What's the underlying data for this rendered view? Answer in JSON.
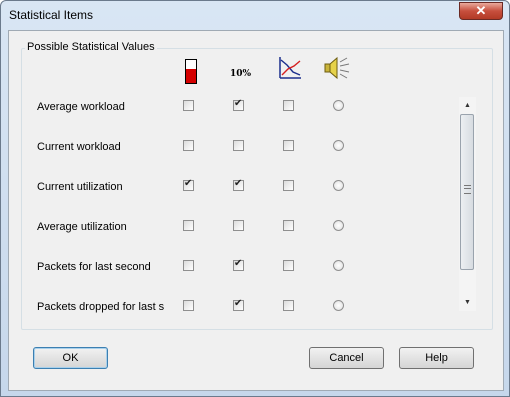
{
  "window": {
    "title": "Statistical Items",
    "close_glyph": "✕"
  },
  "group": {
    "label": "Possible Statistical Values"
  },
  "columns": [
    {
      "icon": "red-bar-gauge-icon"
    },
    {
      "icon": "percent-icon",
      "text": "10%"
    },
    {
      "icon": "line-graph-icon"
    },
    {
      "icon": "speaker-icon"
    }
  ],
  "rows": [
    {
      "label": "Average workload",
      "c1": false,
      "c2": true,
      "c3": false
    },
    {
      "label": "Current workload",
      "c1": false,
      "c2": false,
      "c3": false
    },
    {
      "label": "Current utilization",
      "c1": true,
      "c2": true,
      "c3": false
    },
    {
      "label": "Average utilization",
      "c1": false,
      "c2": false,
      "c3": false
    },
    {
      "label": "Packets for last second",
      "c1": false,
      "c2": true,
      "c3": false
    },
    {
      "label": "Packets dropped for last s",
      "c1": false,
      "c2": true,
      "c3": false
    }
  ],
  "buttons": {
    "ok": "OK",
    "cancel": "Cancel",
    "help": "Help"
  },
  "scrollbar": {
    "up": "▲",
    "down": "▼"
  }
}
